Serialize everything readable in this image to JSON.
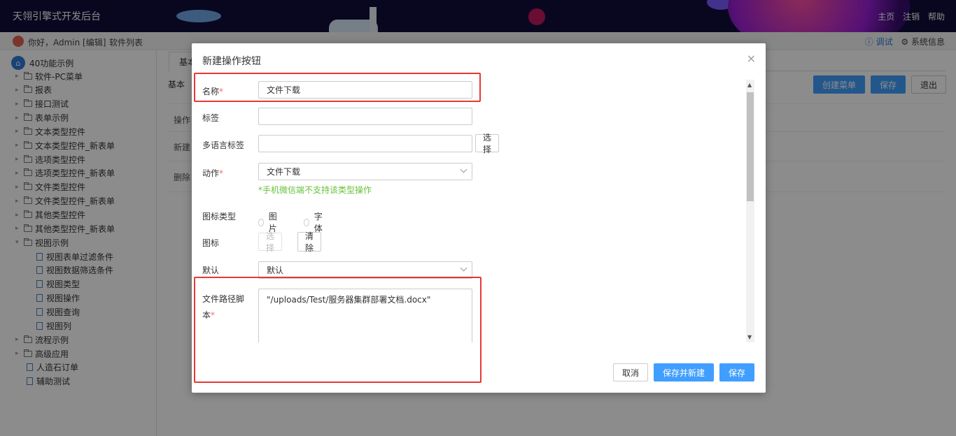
{
  "topbar": {
    "title": "天翎引擎式开发后台",
    "nav": [
      "主页",
      "注销",
      "帮助"
    ]
  },
  "subbar": {
    "greeting": "你好，Admin [编辑]",
    "software_list": "软件列表",
    "debug": "ⓘ 调试",
    "system_info": "⚙ 系统信息"
  },
  "sidebar": {
    "root": "40功能示例",
    "items": [
      {
        "label": "软件-PC菜单",
        "type": "folder",
        "caret": "▸"
      },
      {
        "label": "报表",
        "type": "folder",
        "caret": "▸"
      },
      {
        "label": "接口测试",
        "type": "folder",
        "caret": "▸"
      },
      {
        "label": "表单示例",
        "type": "folder",
        "caret": "▸"
      },
      {
        "label": "文本类型控件",
        "type": "folder",
        "caret": "▸"
      },
      {
        "label": "文本类型控件_新表单",
        "type": "folder",
        "caret": "▸"
      },
      {
        "label": "选项类型控件",
        "type": "folder",
        "caret": "▸"
      },
      {
        "label": "选项类型控件_新表单",
        "type": "folder",
        "caret": "▸"
      },
      {
        "label": "文件类型控件",
        "type": "folder",
        "caret": "▸"
      },
      {
        "label": "文件类型控件_新表单",
        "type": "folder",
        "caret": "▸"
      },
      {
        "label": "其他类型控件",
        "type": "folder",
        "caret": "▸"
      },
      {
        "label": "其他类型控件_新表单",
        "type": "folder",
        "caret": "▸"
      },
      {
        "label": "视图示例",
        "type": "folder",
        "caret": "▾"
      },
      {
        "label": "视图表单过滤条件",
        "type": "file",
        "caret": ""
      },
      {
        "label": "视图数据筛选条件",
        "type": "file",
        "caret": ""
      },
      {
        "label": "视图类型",
        "type": "file",
        "caret": ""
      },
      {
        "label": "视图操作",
        "type": "file",
        "caret": ""
      },
      {
        "label": "视图查询",
        "type": "file",
        "caret": ""
      },
      {
        "label": "视图列",
        "type": "file",
        "caret": ""
      },
      {
        "label": "流程示例",
        "type": "folder",
        "caret": "▸"
      },
      {
        "label": "高级应用",
        "type": "folder",
        "caret": "▸"
      },
      {
        "label": "人造石订单",
        "type": "file",
        "caret": ""
      },
      {
        "label": "辅助测试",
        "type": "file",
        "caret": ""
      }
    ]
  },
  "content": {
    "tab": "基本",
    "crumb": "基本",
    "buttons": {
      "create_menu": "创建菜单",
      "save": "保存",
      "exit": "退出"
    },
    "row_labels": [
      "操作",
      "新建",
      "删除"
    ]
  },
  "modal": {
    "title": "新建操作按钮",
    "close": "×",
    "fields": {
      "name": {
        "label": "名称",
        "required": "*",
        "value": "文件下载"
      },
      "tag": {
        "label": "标签",
        "value": ""
      },
      "i18n": {
        "label": "多语言标签",
        "value": "",
        "button": "选择"
      },
      "action": {
        "label": "动作",
        "required": "*",
        "value": "文件下载",
        "hint": "*手机微信端不支持该类型操作"
      },
      "icon_type": {
        "label": "图标类型",
        "options": [
          "图片",
          "字体"
        ]
      },
      "icon": {
        "label": "图标",
        "select": "选择",
        "clear": "清除"
      },
      "default": {
        "label": "默认",
        "value": "默认"
      },
      "file_path": {
        "label_line1": "文件路径脚",
        "label_line2": "本",
        "required": "*",
        "value": "\"/uploads/Test/服务器集群部署文档.docx\""
      }
    },
    "footer": {
      "cancel": "取消",
      "save_new": "保存并新建",
      "save": "保存"
    }
  },
  "scroll_arrows": {
    "up": "▲",
    "down": "▼"
  }
}
